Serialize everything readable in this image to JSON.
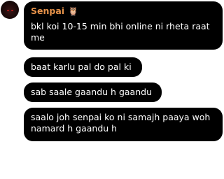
{
  "sender": {
    "name": "Senpai",
    "badge": "🦉"
  },
  "messages": [
    "bkl koi 10-15 min bhi online ni rheta raat me",
    "baat karlu pal do pal ki",
    "sab saale gaandu h gaandu",
    "saalo joh senpai ko ni samajh paaya woh namard h gaandu h"
  ],
  "colors": {
    "bubble": "#000000",
    "text": "#ffffff",
    "sender_name": "#e8934a"
  }
}
